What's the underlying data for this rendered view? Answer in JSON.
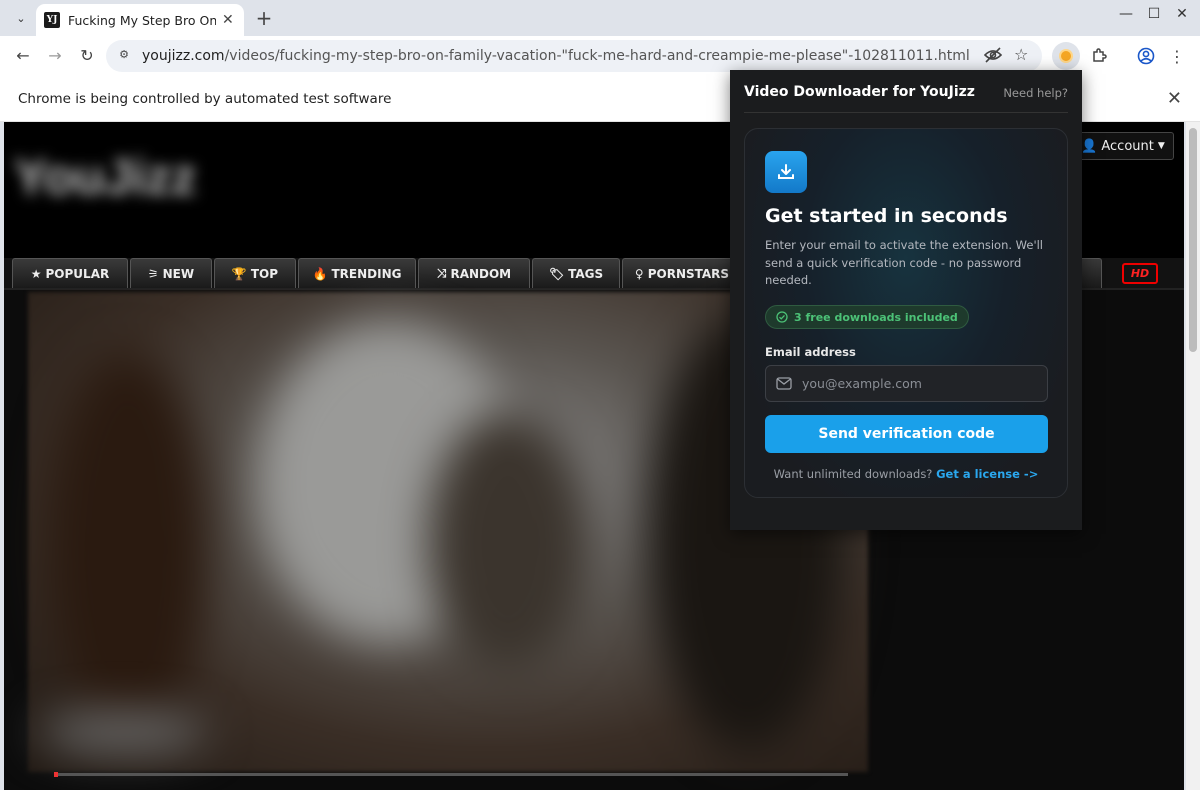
{
  "browser": {
    "tab_title": "Fucking My Step Bro On F",
    "favicon_text": "YJ",
    "url_host": "youjizz.com",
    "url_path": "/videos/fucking-my-step-bro-on-family-vacation-\"fuck-me-hard-and-creampie-me-please\"-102811011.html",
    "infobar_text": "Chrome is being controlled by automated test software"
  },
  "site": {
    "account_label": "Account",
    "nav": [
      "POPULAR",
      "NEW",
      "TOP",
      "TRENDING",
      "RANDOM",
      "TAGS",
      "PORNSTARS"
    ],
    "nav_partial": "S",
    "hd_label": "HD",
    "progress": 0.005
  },
  "popup": {
    "title": "Video Downloader for YouJizz",
    "help": "Need help?",
    "heading": "Get started in seconds",
    "description": "Enter your email to activate the extension. We'll send a quick verification code - no password needed.",
    "badge": "3 free downloads included",
    "email_label": "Email address",
    "email_placeholder": "you@example.com",
    "send_button": "Send verification code",
    "license_prompt": "Want unlimited downloads?",
    "license_link": "Get a license ->"
  },
  "colors": {
    "accent": "#1aa0ea",
    "success": "#4cc277",
    "hd_red": "#ee2222"
  }
}
